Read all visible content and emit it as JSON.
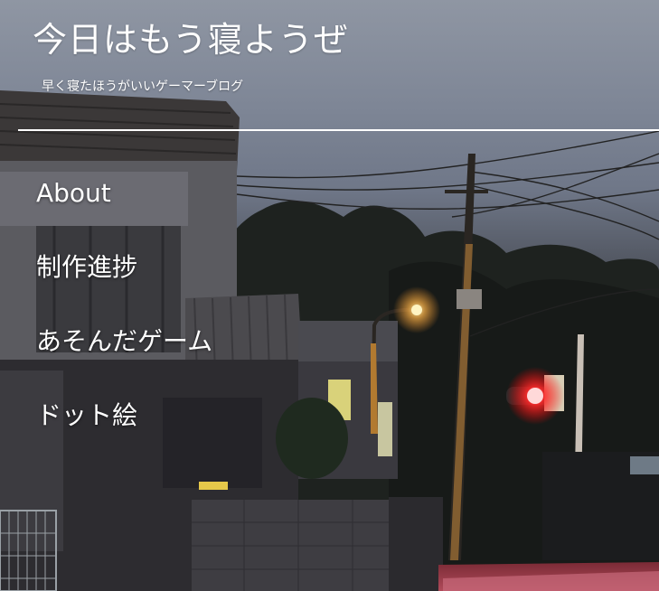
{
  "site": {
    "title": "今日はもう寝ようぜ",
    "tagline": "早く寝たほうがいいゲーマーブログ"
  },
  "nav": {
    "items": [
      {
        "label": "About"
      },
      {
        "label": "制作進捗"
      },
      {
        "label": "あそんだゲーム"
      },
      {
        "label": "ドット絵"
      }
    ]
  },
  "colors": {
    "text": "#ffffff",
    "sky": "#8f96a3",
    "signal_red": "#ff2a2a",
    "street_lamp": "#ffb347"
  }
}
